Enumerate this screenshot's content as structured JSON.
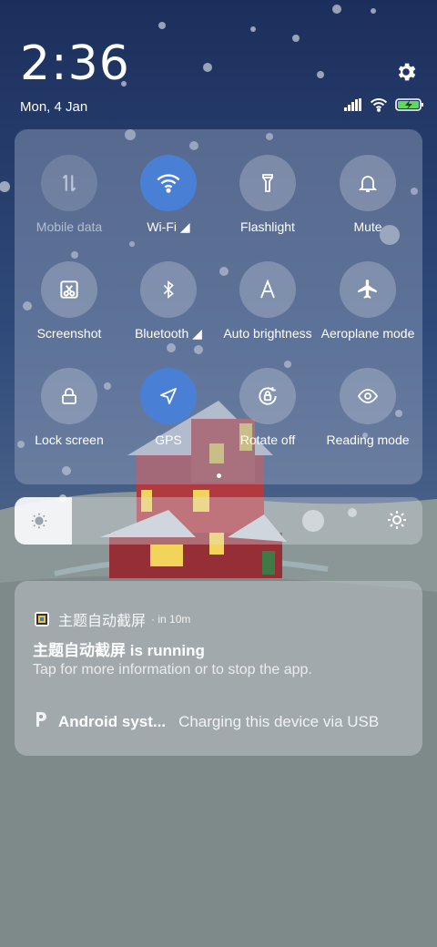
{
  "status": {
    "time": "2:36",
    "date": "Mon, 4 Jan"
  },
  "quick_settings": {
    "tiles": [
      {
        "label": "Mobile data",
        "icon": "mobile-data-icon",
        "state": "off"
      },
      {
        "label": "Wi-Fi ◢",
        "icon": "wifi-icon",
        "state": "on"
      },
      {
        "label": "Flashlight",
        "icon": "flashlight-icon",
        "state": "off"
      },
      {
        "label": "Mute",
        "icon": "bell-icon",
        "state": "off"
      },
      {
        "label": "Screenshot",
        "icon": "screenshot-icon",
        "state": "off"
      },
      {
        "label": "Bluetooth ◢",
        "icon": "bluetooth-icon",
        "state": "off"
      },
      {
        "label": "Auto brightness",
        "icon": "auto-brightness-icon",
        "state": "off"
      },
      {
        "label": "Aeroplane mode",
        "icon": "airplane-icon",
        "state": "off"
      },
      {
        "label": "Lock screen",
        "icon": "lock-icon",
        "state": "off"
      },
      {
        "label": "GPS",
        "icon": "location-arrow-icon",
        "state": "on"
      },
      {
        "label": "Rotate off",
        "icon": "rotation-lock-icon",
        "state": "off"
      },
      {
        "label": "Reading mode",
        "icon": "eye-icon",
        "state": "off"
      }
    ],
    "page_count": 2,
    "active_page": 1
  },
  "brightness": {
    "level": 0.14
  },
  "notifications": {
    "app": {
      "name": "主题自动截屏",
      "time": "· in 10m",
      "title": "主题自动截屏 is running",
      "body": "Tap for more information or to stop the app."
    },
    "system": {
      "name": "Android syst...",
      "message": "Charging this device via USB"
    }
  },
  "colors": {
    "accent": "#4a7fd6",
    "sky_top": "#1d3260",
    "snow": "#7e8a8a"
  }
}
